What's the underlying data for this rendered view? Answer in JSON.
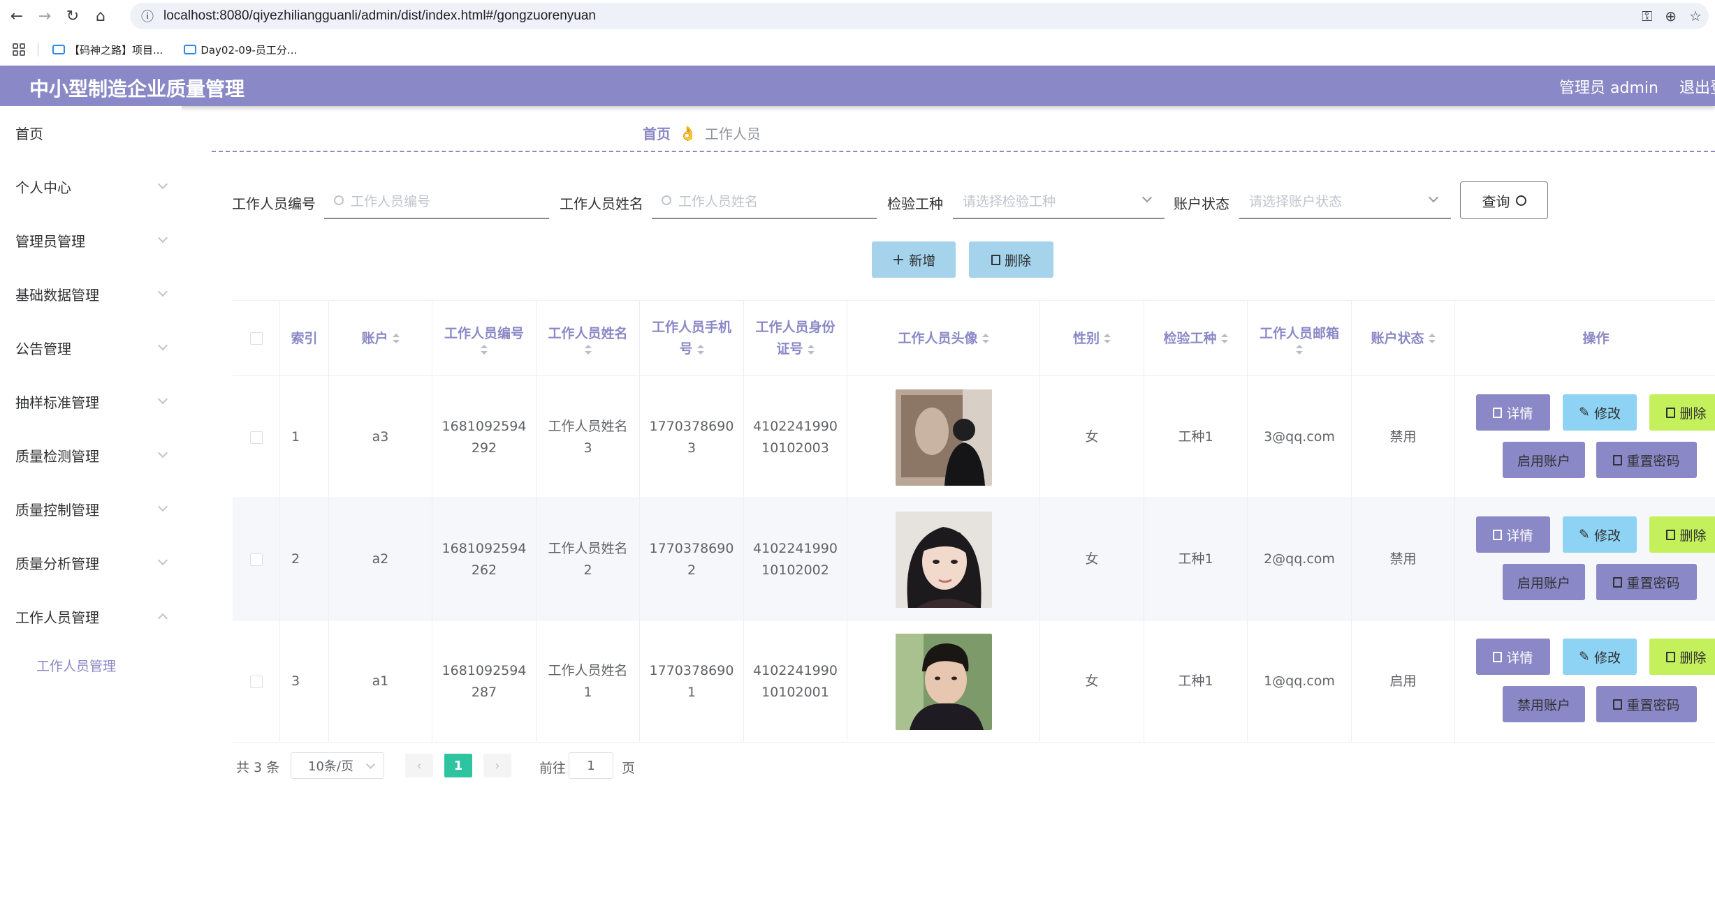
{
  "browser": {
    "url": "localhost:8080/qiyezhiliangguanli/admin/dist/index.html#/gongzuorenyuan",
    "bookmarks": [
      "【码神之路】项目...",
      "Day02-09-员工分..."
    ]
  },
  "header": {
    "title": "中小型制造企业质量管理",
    "admin": "管理员 admin",
    "logout": "退出登录"
  },
  "sidebar": {
    "items": [
      {
        "label": "首页",
        "expandable": false
      },
      {
        "label": "个人中心",
        "expandable": true
      },
      {
        "label": "管理员管理",
        "expandable": true
      },
      {
        "label": "基础数据管理",
        "expandable": true
      },
      {
        "label": "公告管理",
        "expandable": true
      },
      {
        "label": "抽样标准管理",
        "expandable": true
      },
      {
        "label": "质量检测管理",
        "expandable": true
      },
      {
        "label": "质量控制管理",
        "expandable": true
      },
      {
        "label": "质量分析管理",
        "expandable": true
      },
      {
        "label": "工作人员管理",
        "expandable": true,
        "expanded": true
      }
    ],
    "sub_item": "工作人员管理"
  },
  "breadcrumb": {
    "home": "首页",
    "separator": "👌",
    "current": "工作人员"
  },
  "search": {
    "id_label": "工作人员编号",
    "id_placeholder": "工作人员编号",
    "name_label": "工作人员姓名",
    "name_placeholder": "工作人员姓名",
    "type_label": "检验工种",
    "type_placeholder": "请选择检验工种",
    "status_label": "账户状态",
    "status_placeholder": "请选择账户状态",
    "query_label": "查询"
  },
  "actions": {
    "add_label": "新增",
    "delete_label": "删除"
  },
  "table": {
    "headers": {
      "index": "索引",
      "account": "账户",
      "staff_id_1": "工作人员编号",
      "staff_name_1": "工作人员姓名",
      "phone_1": "工作人员手机",
      "phone_2": "号",
      "idcard_1": "工作人员身份",
      "idcard_2": "证号",
      "avatar": "工作人员头像",
      "gender": "性别",
      "type": "检验工种",
      "email_1": "工作人员邮箱",
      "status": "账户状态",
      "ops": "操作"
    },
    "rows": [
      {
        "index": "1",
        "account": "a3",
        "id_1": "1681092594",
        "id_2": "292",
        "name_1": "工作人员姓名",
        "name_2": "3",
        "phone_1": "1770378690",
        "phone_2": "3",
        "idcard_1": "4102241990",
        "idcard_2": "10102003",
        "gender": "女",
        "type": "工种1",
        "email": "3@qq.com",
        "status": "禁用",
        "toggle": "启用账户"
      },
      {
        "index": "2",
        "account": "a2",
        "id_1": "1681092594",
        "id_2": "262",
        "name_1": "工作人员姓名",
        "name_2": "2",
        "phone_1": "1770378690",
        "phone_2": "2",
        "idcard_1": "4102241990",
        "idcard_2": "10102002",
        "gender": "女",
        "type": "工种1",
        "email": "2@qq.com",
        "status": "禁用",
        "toggle": "启用账户"
      },
      {
        "index": "3",
        "account": "a1",
        "id_1": "1681092594",
        "id_2": "287",
        "name_1": "工作人员姓名",
        "name_2": "1",
        "phone_1": "1770378690",
        "phone_2": "1",
        "idcard_1": "4102241990",
        "idcard_2": "10102001",
        "gender": "女",
        "type": "工种1",
        "email": "1@qq.com",
        "status": "启用",
        "toggle": "禁用账户"
      }
    ],
    "op_labels": {
      "detail": "详情",
      "edit": "修改",
      "delete": "删除",
      "reset": "重置密码"
    }
  },
  "pagination": {
    "total": "共 3 条",
    "page_size": "10条/页",
    "current_page": "1",
    "goto_prefix": "前往",
    "goto_value": "1",
    "goto_suffix": "页"
  },
  "colors": {
    "theme": "#8a88c6",
    "edit_button": "#8fd3f4",
    "delete_button": "#c3f05b",
    "add_button": "#a5d3ec",
    "page_active": "#2ec4a0"
  }
}
